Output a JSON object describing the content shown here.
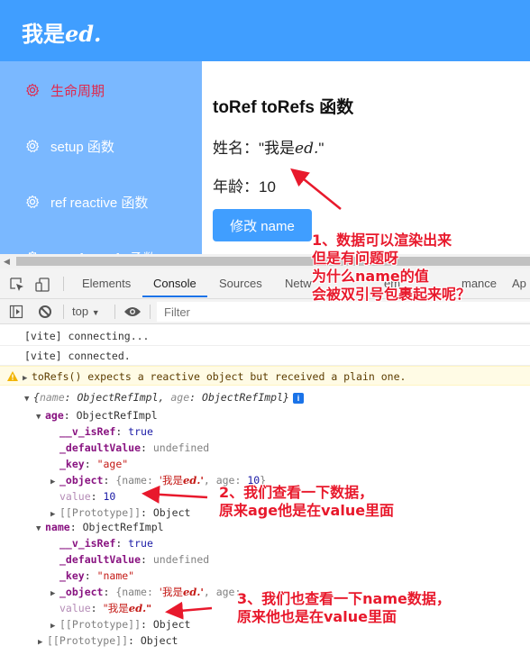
{
  "app": {
    "title_cjk": "我是",
    "title_latin": "ed."
  },
  "sidebar": {
    "items": [
      {
        "label": "生命周期",
        "icon": "gear-icon",
        "active": true
      },
      {
        "label": "setup 函数",
        "icon": "gear-icon",
        "active": false
      },
      {
        "label": "ref reactive 函数",
        "icon": "gear-icon",
        "active": false
      },
      {
        "label": "toRef toRefs 函数",
        "icon": "gear-icon",
        "active": false
      }
    ]
  },
  "main": {
    "title": "toRef toRefs 函数",
    "name_label": "姓名：",
    "name_value_prefix": "\"我是",
    "name_value_latin": "ed.",
    "name_value_suffix": "\"",
    "age_label": "年龄：",
    "age_value": "10",
    "edit_button": "修改 name"
  },
  "devtools": {
    "tabs": [
      {
        "label": "Elements",
        "active": false
      },
      {
        "label": "Console",
        "active": true
      },
      {
        "label": "Sources",
        "active": false
      },
      {
        "label": "Network",
        "active": false
      },
      {
        "label": "Memory",
        "active": false
      },
      {
        "label": "Performance",
        "active": false
      },
      {
        "label": "Application",
        "active": false
      }
    ],
    "tabs_visible": {
      "network": "Netw",
      "memory_tail": "em",
      "performance_tail": "mance",
      "application": "Ap"
    },
    "toolbar": {
      "context": "top",
      "filter_placeholder": "Filter"
    }
  },
  "console": {
    "lines": {
      "vite_connecting": "[vite] connecting...",
      "vite_connected": "[vite] connected.",
      "warning": "toRefs() expects a reactive object but received a plain one.",
      "object_summary_open": "{",
      "object_summary_name_key": "name",
      "object_summary_name_type": "ObjectRefImpl",
      "object_summary_age_key": "age",
      "object_summary_age_type": "ObjectRefImpl",
      "object_summary_close": "}",
      "info_badge": "i"
    },
    "age": {
      "key": "age",
      "type": "ObjectRefImpl",
      "is_ref_key": "__v_isRef",
      "is_ref_value": "true",
      "default_key": "_defaultValue",
      "default_value": "undefined",
      "key_key": "_key",
      "key_value": "\"age\"",
      "object_key": "_object",
      "object_preview_prefix": "{name: ",
      "object_preview_name_cjk": "'我是",
      "object_preview_name_latin": "ed.'",
      "object_preview_age": ", age: ",
      "object_preview_age_value": "10",
      "object_preview_close": "}",
      "value_key": "value",
      "value_value": "10",
      "prototype": "[[Prototype]]",
      "prototype_value": "Object"
    },
    "name": {
      "key": "name",
      "type": "ObjectRefImpl",
      "is_ref_key": "__v_isRef",
      "is_ref_value": "true",
      "default_key": "_defaultValue",
      "default_value": "undefined",
      "key_key": "_key",
      "key_value": "\"name\"",
      "object_key": "_object",
      "object_preview_prefix": "{name: ",
      "object_preview_name_cjk": "'我是",
      "object_preview_name_latin": "ed.'",
      "object_preview_age": ", age: ",
      "value_key": "value",
      "value_cjk": "\"我是",
      "value_latin": "ed.\"",
      "prototype": "[[Prototype]]",
      "prototype_value": "Object"
    },
    "root_prototype": "[[Prototype]]",
    "root_prototype_value": "Object"
  },
  "annotations": {
    "note1": [
      "1、数据可以渲染出来",
      "但是有问题呀",
      "为什么name的值",
      "会被双引号包裹起来呢？"
    ],
    "note2": [
      "2、我们查看一下数据，",
      "原来age他是在value里面"
    ],
    "note3": [
      "3、我们也查看一下name数据，",
      "原来他也是在value里面"
    ],
    "color": "#e8192c"
  },
  "colors": {
    "header_bg": "#409eff",
    "sidebar_bg": "#7ab8ff",
    "active_item": "#e0284d",
    "button_bg": "#409eff"
  }
}
